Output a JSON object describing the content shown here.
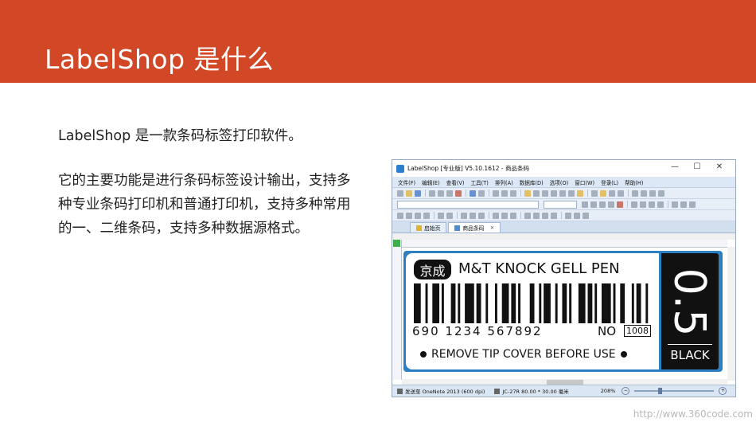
{
  "slide": {
    "title": "LabelShop  是什么",
    "para1": "LabelShop 是一款条码标签打印软件。",
    "para2": "它的主要功能是进行条码标签设计输出，支持多种专业条码打印机和普通打印机，支持多种常用的一、二维条码，支持多种数据源格式。",
    "watermark": "http://www.360code.com"
  },
  "colors": {
    "banner": "#d24726",
    "label_border": "#2c7fc0",
    "label_black": "#111111"
  },
  "app": {
    "window_title": "LabelShop [专业版]  V5.10.1612   - 商品条码",
    "window_buttons": {
      "minimize": "—",
      "maximize": "☐",
      "close": "✕"
    },
    "menus": [
      "文件(F)",
      "编辑(E)",
      "查看(V)",
      "工具(T)",
      "排列(A)",
      "数据库(D)",
      "选项(O)",
      "窗口(W)",
      "登录(L)",
      "帮助(H)"
    ],
    "tabs": [
      {
        "label": "启始页"
      },
      {
        "label": "商品条码",
        "close": "×"
      }
    ],
    "statusbar": {
      "printer": "发送至 OneNote 2013 (600 dpi)",
      "label_size": "JC-27R  80.00 * 30.00 毫米",
      "zoom": "208%"
    }
  },
  "label": {
    "logo_text": "京成",
    "product_name": "M&T KNOCK GELL PEN",
    "barcode_digits": "690 1234 567892",
    "no_label": "NO",
    "no_value": "1008",
    "footer": "REMOVE TIP COVER BEFORE USE",
    "size": "0.5",
    "color": "BLACK"
  }
}
